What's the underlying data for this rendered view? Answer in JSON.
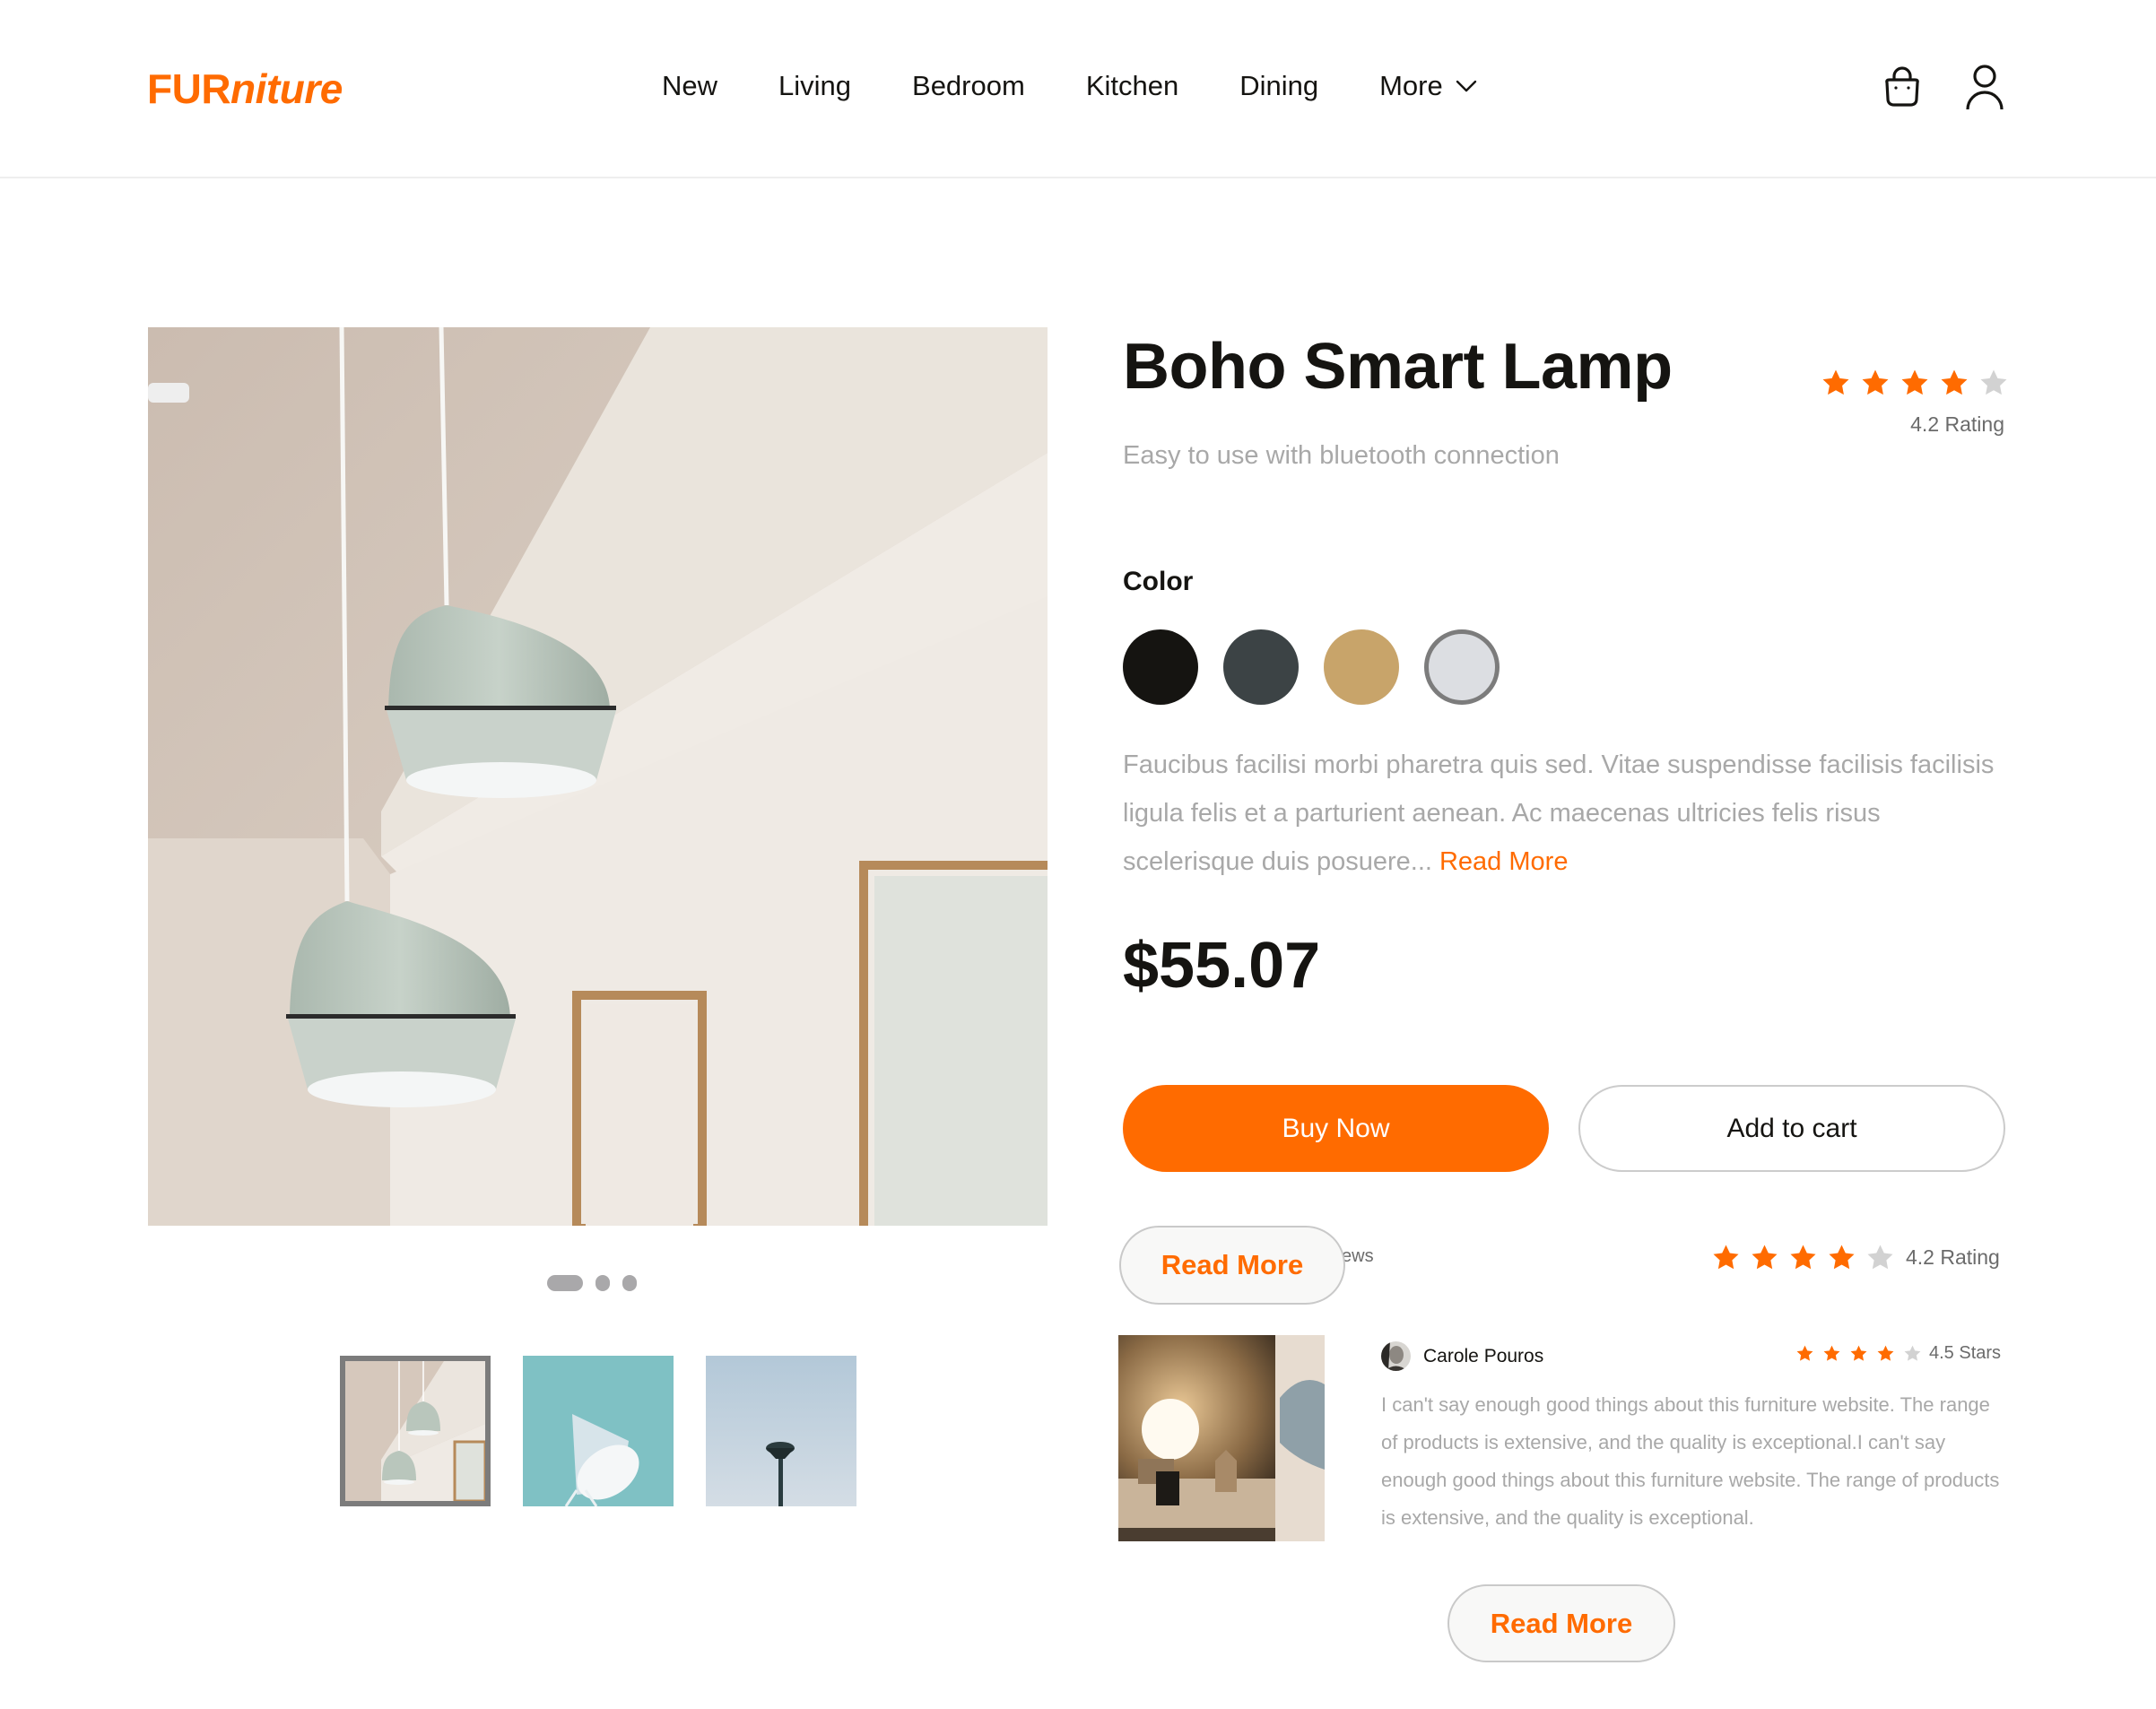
{
  "brand": {
    "logo_upper": "FUR",
    "logo_italic": "niture",
    "accent_color": "#ff6b00"
  },
  "nav": {
    "items": [
      {
        "label": "New"
      },
      {
        "label": "Living"
      },
      {
        "label": "Bedroom"
      },
      {
        "label": "Kitchen"
      },
      {
        "label": "Dining"
      },
      {
        "label": "More",
        "icon": "chevron-down-icon"
      }
    ],
    "icons": [
      "shopping-bag-icon",
      "user-icon"
    ]
  },
  "gallery": {
    "main_image": "pendant-lamps-photo",
    "carousel": {
      "slides": 3,
      "active": 1
    },
    "thumbnails": [
      {
        "name": "pendant-lamps-thumb",
        "selected": true
      },
      {
        "name": "teal-desk-lamp-thumb",
        "selected": false
      },
      {
        "name": "street-lamp-thumb",
        "selected": false
      }
    ]
  },
  "product": {
    "title": "Boho Smart Lamp",
    "subtitle": "Easy to use with bluetooth connection",
    "rating": {
      "value": 4.2,
      "stars_filled": 4,
      "stars_total": 5,
      "label": "4.2 Rating"
    },
    "color_label": "Color",
    "colors": [
      {
        "name": "black",
        "hex": "#151411",
        "selected": false
      },
      {
        "name": "charcoal",
        "hex": "#3c4345",
        "selected": false
      },
      {
        "name": "sand",
        "hex": "#c8a46a",
        "selected": false
      },
      {
        "name": "light-grey",
        "hex": "#dcdee2",
        "selected": true
      }
    ],
    "description": "Faucibus facilisi morbi pharetra quis sed. Vitae suspendisse facilisis facilisis ligula felis et a parturient aenean. Ac maecenas ultricies felis risus scelerisque duis posuere...",
    "read_more": "Read More",
    "price": "$55.07",
    "buy_now": "Buy Now",
    "add_to_cart": "Add to cart"
  },
  "reviews": {
    "label_partial": "ews",
    "read_more_overlay": "Read More",
    "rating": {
      "value": 4.2,
      "stars_filled": 4,
      "stars_total": 5,
      "label": "4.2 Rating"
    },
    "items": [
      {
        "reviewer": "Carole Pouros",
        "stars_filled": 4,
        "stars_total": 5,
        "stars_label": "4.5 Stars",
        "text": "I can't say enough good things about this furniture website. The range of products is extensive, and the quality is exceptional.I can't say enough good things about this furniture website. The range of products is extensive, and the quality is exceptional."
      }
    ],
    "read_more_bottom": "Read More"
  }
}
